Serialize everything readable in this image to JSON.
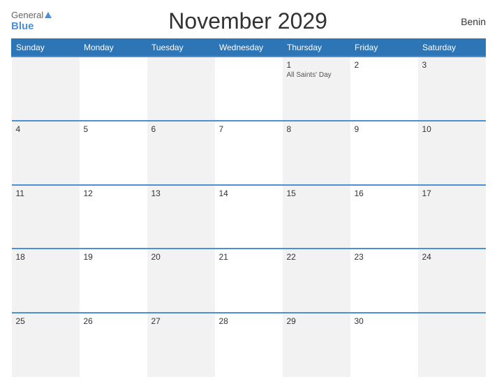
{
  "header": {
    "title": "November 2029",
    "country": "Benin",
    "logo_general": "General",
    "logo_blue": "Blue"
  },
  "weekdays": [
    "Sunday",
    "Monday",
    "Tuesday",
    "Wednesday",
    "Thursday",
    "Friday",
    "Saturday"
  ],
  "weeks": [
    [
      {
        "day": "",
        "holiday": ""
      },
      {
        "day": "",
        "holiday": ""
      },
      {
        "day": "",
        "holiday": ""
      },
      {
        "day": "",
        "holiday": ""
      },
      {
        "day": "1",
        "holiday": "All Saints' Day"
      },
      {
        "day": "2",
        "holiday": ""
      },
      {
        "day": "3",
        "holiday": ""
      }
    ],
    [
      {
        "day": "4",
        "holiday": ""
      },
      {
        "day": "5",
        "holiday": ""
      },
      {
        "day": "6",
        "holiday": ""
      },
      {
        "day": "7",
        "holiday": ""
      },
      {
        "day": "8",
        "holiday": ""
      },
      {
        "day": "9",
        "holiday": ""
      },
      {
        "day": "10",
        "holiday": ""
      }
    ],
    [
      {
        "day": "11",
        "holiday": ""
      },
      {
        "day": "12",
        "holiday": ""
      },
      {
        "day": "13",
        "holiday": ""
      },
      {
        "day": "14",
        "holiday": ""
      },
      {
        "day": "15",
        "holiday": ""
      },
      {
        "day": "16",
        "holiday": ""
      },
      {
        "day": "17",
        "holiday": ""
      }
    ],
    [
      {
        "day": "18",
        "holiday": ""
      },
      {
        "day": "19",
        "holiday": ""
      },
      {
        "day": "20",
        "holiday": ""
      },
      {
        "day": "21",
        "holiday": ""
      },
      {
        "day": "22",
        "holiday": ""
      },
      {
        "day": "23",
        "holiday": ""
      },
      {
        "day": "24",
        "holiday": ""
      }
    ],
    [
      {
        "day": "25",
        "holiday": ""
      },
      {
        "day": "26",
        "holiday": ""
      },
      {
        "day": "27",
        "holiday": ""
      },
      {
        "day": "28",
        "holiday": ""
      },
      {
        "day": "29",
        "holiday": ""
      },
      {
        "day": "30",
        "holiday": ""
      },
      {
        "day": "",
        "holiday": ""
      }
    ]
  ]
}
